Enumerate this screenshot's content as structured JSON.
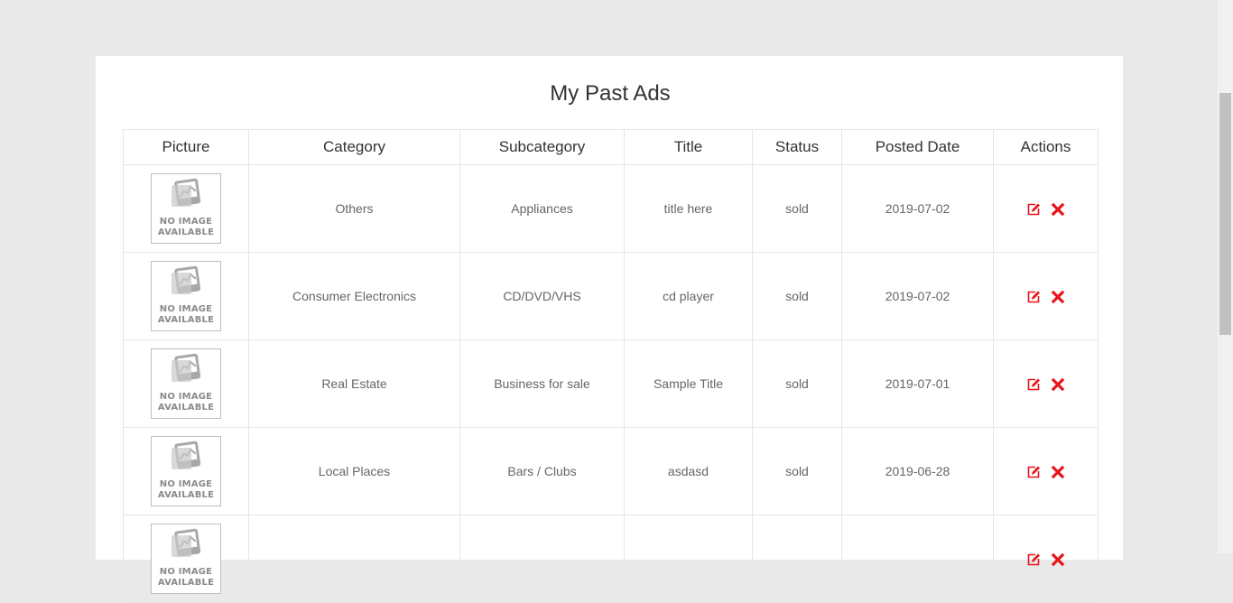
{
  "page": {
    "title": "My Past Ads"
  },
  "table": {
    "headers": [
      "Picture",
      "Category",
      "Subcategory",
      "Title",
      "Status",
      "Posted Date",
      "Actions"
    ],
    "placeholder_line1": "NO IMAGE",
    "placeholder_line2": "AVAILABLE",
    "rows": [
      {
        "category": "Others",
        "subcategory": "Appliances",
        "title": "title here",
        "status": "sold",
        "date": "2019-07-02"
      },
      {
        "category": "Consumer Electronics",
        "subcategory": "CD/DVD/VHS",
        "title": "cd player",
        "status": "sold",
        "date": "2019-07-02"
      },
      {
        "category": "Real Estate",
        "subcategory": "Business for sale",
        "title": "Sample Title",
        "status": "sold",
        "date": "2019-07-01"
      },
      {
        "category": "Local Places",
        "subcategory": "Bars / Clubs",
        "title": "asdasd",
        "status": "sold",
        "date": "2019-06-28"
      },
      {
        "category": "",
        "subcategory": "",
        "title": "",
        "status": "",
        "date": ""
      }
    ]
  },
  "icons": {
    "edit": "edit-icon",
    "delete": "delete-icon",
    "placeholder": "photo-icon"
  },
  "colors": {
    "action_red": "#e8141a",
    "background": "#e9e9e9"
  }
}
